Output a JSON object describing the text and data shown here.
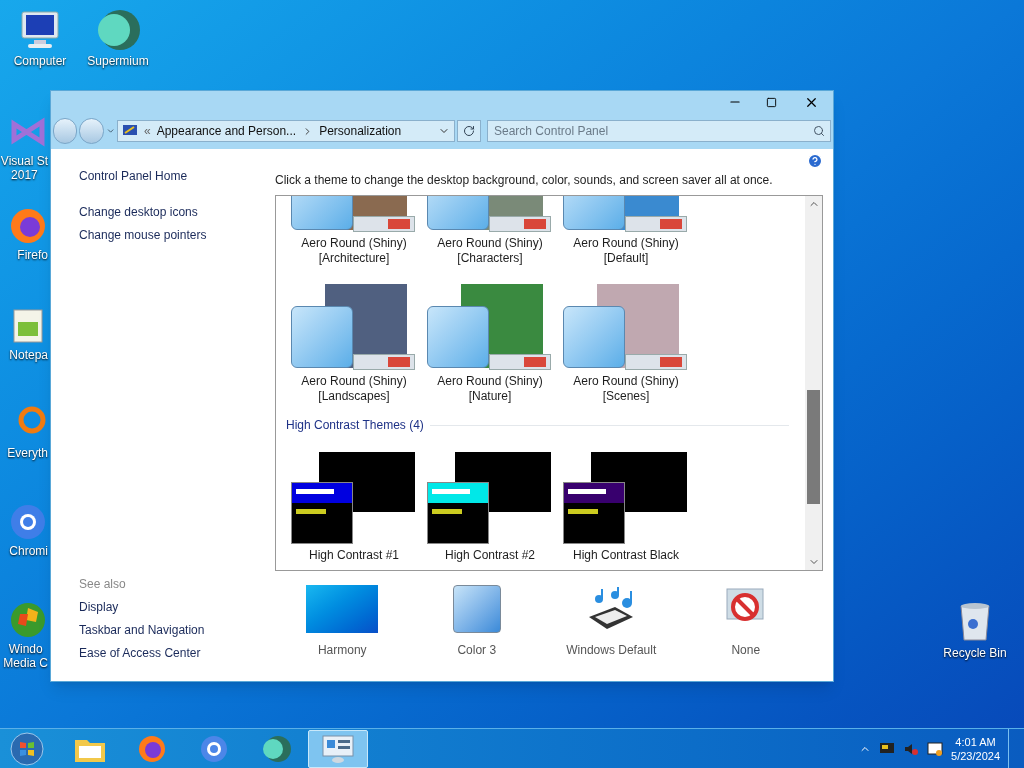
{
  "desktop_icons": [
    {
      "kind": "computer",
      "lines": [
        "Computer"
      ]
    },
    {
      "kind": "supermium",
      "lines": [
        "Supermium"
      ]
    },
    {
      "kind": "visual-studio",
      "lines": [
        "Visual St",
        "2017"
      ]
    },
    {
      "kind": "firefox",
      "lines": [
        "Firefo"
      ]
    },
    {
      "kind": "notepad",
      "lines": [
        "Notepa"
      ]
    },
    {
      "kind": "everything",
      "lines": [
        "Everyth"
      ]
    },
    {
      "kind": "chromium",
      "lines": [
        "Chromi"
      ]
    },
    {
      "kind": "media-center",
      "lines": [
        "Windo",
        "Media C"
      ]
    },
    {
      "kind": "recycle-bin",
      "lines": [
        "Recycle Bin"
      ]
    }
  ],
  "window": {
    "address": {
      "overflow_mark": "«",
      "crumbs": [
        "Appearance and Person...",
        "Personalization"
      ]
    },
    "search": {
      "placeholder": "Search Control Panel"
    },
    "sidebar": {
      "links": [
        "Control Panel Home",
        "Change desktop icons",
        "Change mouse pointers"
      ],
      "see_also": {
        "title": "See also",
        "links": [
          "Display",
          "Taskbar and Navigation",
          "Ease of Access Center"
        ]
      }
    },
    "description": "Click a theme to change the desktop background, color, sounds, and screen saver all at once.",
    "theme_groups": [
      {
        "themes": [
          {
            "kind": "aero",
            "lines": [
              "Aero Round (Shiny)",
              "[Architecture]"
            ]
          },
          {
            "kind": "aero",
            "lines": [
              "Aero Round (Shiny)",
              "[Characters]"
            ]
          },
          {
            "kind": "aero",
            "lines": [
              "Aero Round (Shiny)",
              "[Default]"
            ]
          },
          {
            "kind": "aero",
            "lines": [
              "Aero Round (Shiny)",
              "[Landscapes]"
            ]
          },
          {
            "kind": "aero",
            "lines": [
              "Aero Round (Shiny)",
              "[Nature]"
            ]
          },
          {
            "kind": "aero",
            "lines": [
              "Aero Round (Shiny)",
              "[Scenes]"
            ]
          }
        ]
      },
      {
        "heading": "High Contrast Themes (4)",
        "themes": [
          {
            "kind": "contrast",
            "color": "#0000e0",
            "lines": [
              "High Contrast #1"
            ]
          },
          {
            "kind": "contrast",
            "color": "#00e8e8",
            "lines": [
              "High Contrast #2"
            ]
          },
          {
            "kind": "contrast",
            "color": "#38006e",
            "lines": [
              "High Contrast Black"
            ]
          }
        ]
      }
    ],
    "settings": [
      {
        "kind": "background",
        "label": "Harmony"
      },
      {
        "kind": "color",
        "label": "Color 3"
      },
      {
        "kind": "sounds",
        "label": "Windows Default"
      },
      {
        "kind": "screensaver",
        "label": "None"
      }
    ]
  },
  "taskbar": {
    "apps": [
      {
        "kind": "folder",
        "selected": false
      },
      {
        "kind": "firefox",
        "selected": false
      },
      {
        "kind": "chromium",
        "selected": false
      },
      {
        "kind": "supermium",
        "selected": false
      },
      {
        "kind": "control-panel",
        "selected": true
      }
    ],
    "clock": {
      "time": "4:01 AM",
      "date": "5/23/2024"
    }
  }
}
